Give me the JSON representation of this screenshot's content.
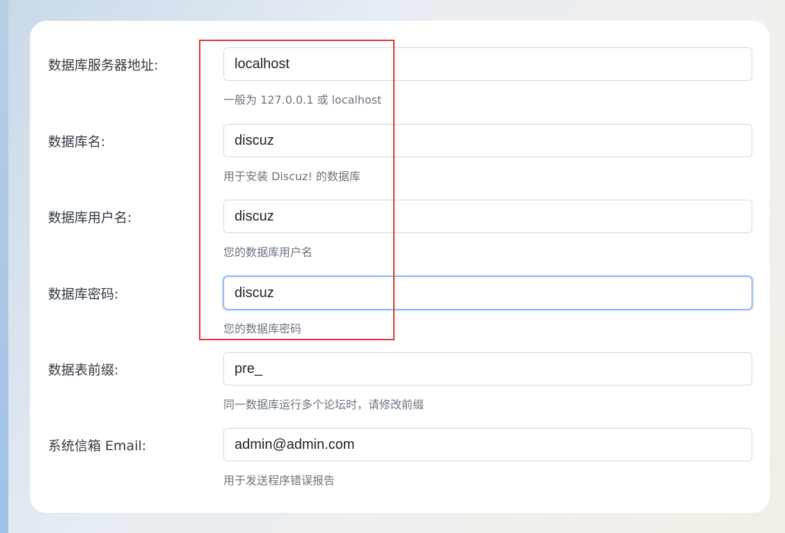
{
  "form": {
    "rows": [
      {
        "label": "数据库服务器地址:",
        "value": "localhost",
        "hint": "一般为 127.0.0.1 或 localhost"
      },
      {
        "label": "数据库名:",
        "value": "discuz",
        "hint": "用于安装 Discuz! 的数据库"
      },
      {
        "label": "数据库用户名:",
        "value": "discuz",
        "hint": "您的数据库用户名"
      },
      {
        "label": "数据库密码:",
        "value": "discuz",
        "hint": "您的数据库密码"
      },
      {
        "label": "数据表前缀:",
        "value": "pre_",
        "hint": "同一数据库运行多个论坛时，请修改前缀"
      },
      {
        "label": "系统信箱 Email:",
        "value": "admin@admin.com",
        "hint": "用于发送程序错误报告"
      }
    ]
  },
  "colors": {
    "highlight": "#e0312c",
    "focus_border": "#6fa0e6"
  }
}
